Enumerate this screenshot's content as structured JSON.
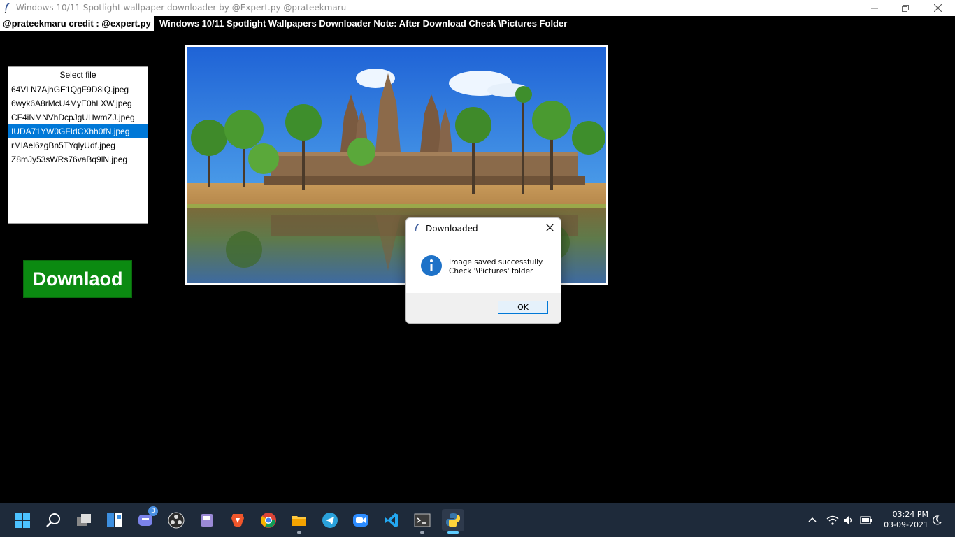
{
  "window": {
    "title": "Windows 10/11 Spotlight wallpaper downloader by @Expert.py @prateekmaru",
    "minimize_icon": "minimize-icon",
    "maximize_icon": "restore-icon",
    "close_icon": "close-icon"
  },
  "header": {
    "credit_label": "@prateekmaru credit : @expert.py",
    "note_label": "Windows 10/11 Spotlight Wallpapers Downloader Note: After Download Check \\Pictures Folder"
  },
  "file_list": {
    "header": "Select file",
    "selected_index": 3,
    "items": [
      "64VLN7AjhGE1QgF9D8iQ.jpeg",
      "6wyk6A8rMcU4MyE0hLXW.jpeg",
      "CF4iNMNVhDcpJgUHwmZJ.jpeg",
      "IUDA71YW0GFIdCXhh0fN.jpeg",
      "rMlAel6zgBn5TYqlyUdf.jpeg",
      "Z8mJy53sWRs76vaBq9lN.jpeg"
    ]
  },
  "download_button": {
    "label": "Downlaod",
    "color": "#0b8a11"
  },
  "dialog": {
    "title": "Downloaded",
    "icon": "info-icon",
    "message_line1": "Image saved successfully.",
    "message_line2": "Check '\\Pictures' folder",
    "ok_label": "OK"
  },
  "taskbar": {
    "icons": [
      "start-icon",
      "search-icon",
      "task-view-icon",
      "widgets-icon",
      "teams-chat-icon",
      "obs-icon",
      "storage-icon",
      "brave-icon",
      "chrome-icon",
      "file-explorer-icon",
      "telegram-icon",
      "zoom-icon",
      "vscode-icon",
      "terminal-icon",
      "python-icon"
    ],
    "chat_badge": "3",
    "clock_time": "03:24 PM",
    "clock_date": "03-09-2021"
  },
  "colors": {
    "accent": "#0078d7",
    "taskbar_bg": "#1e2a3a",
    "app_bg": "#000000"
  }
}
